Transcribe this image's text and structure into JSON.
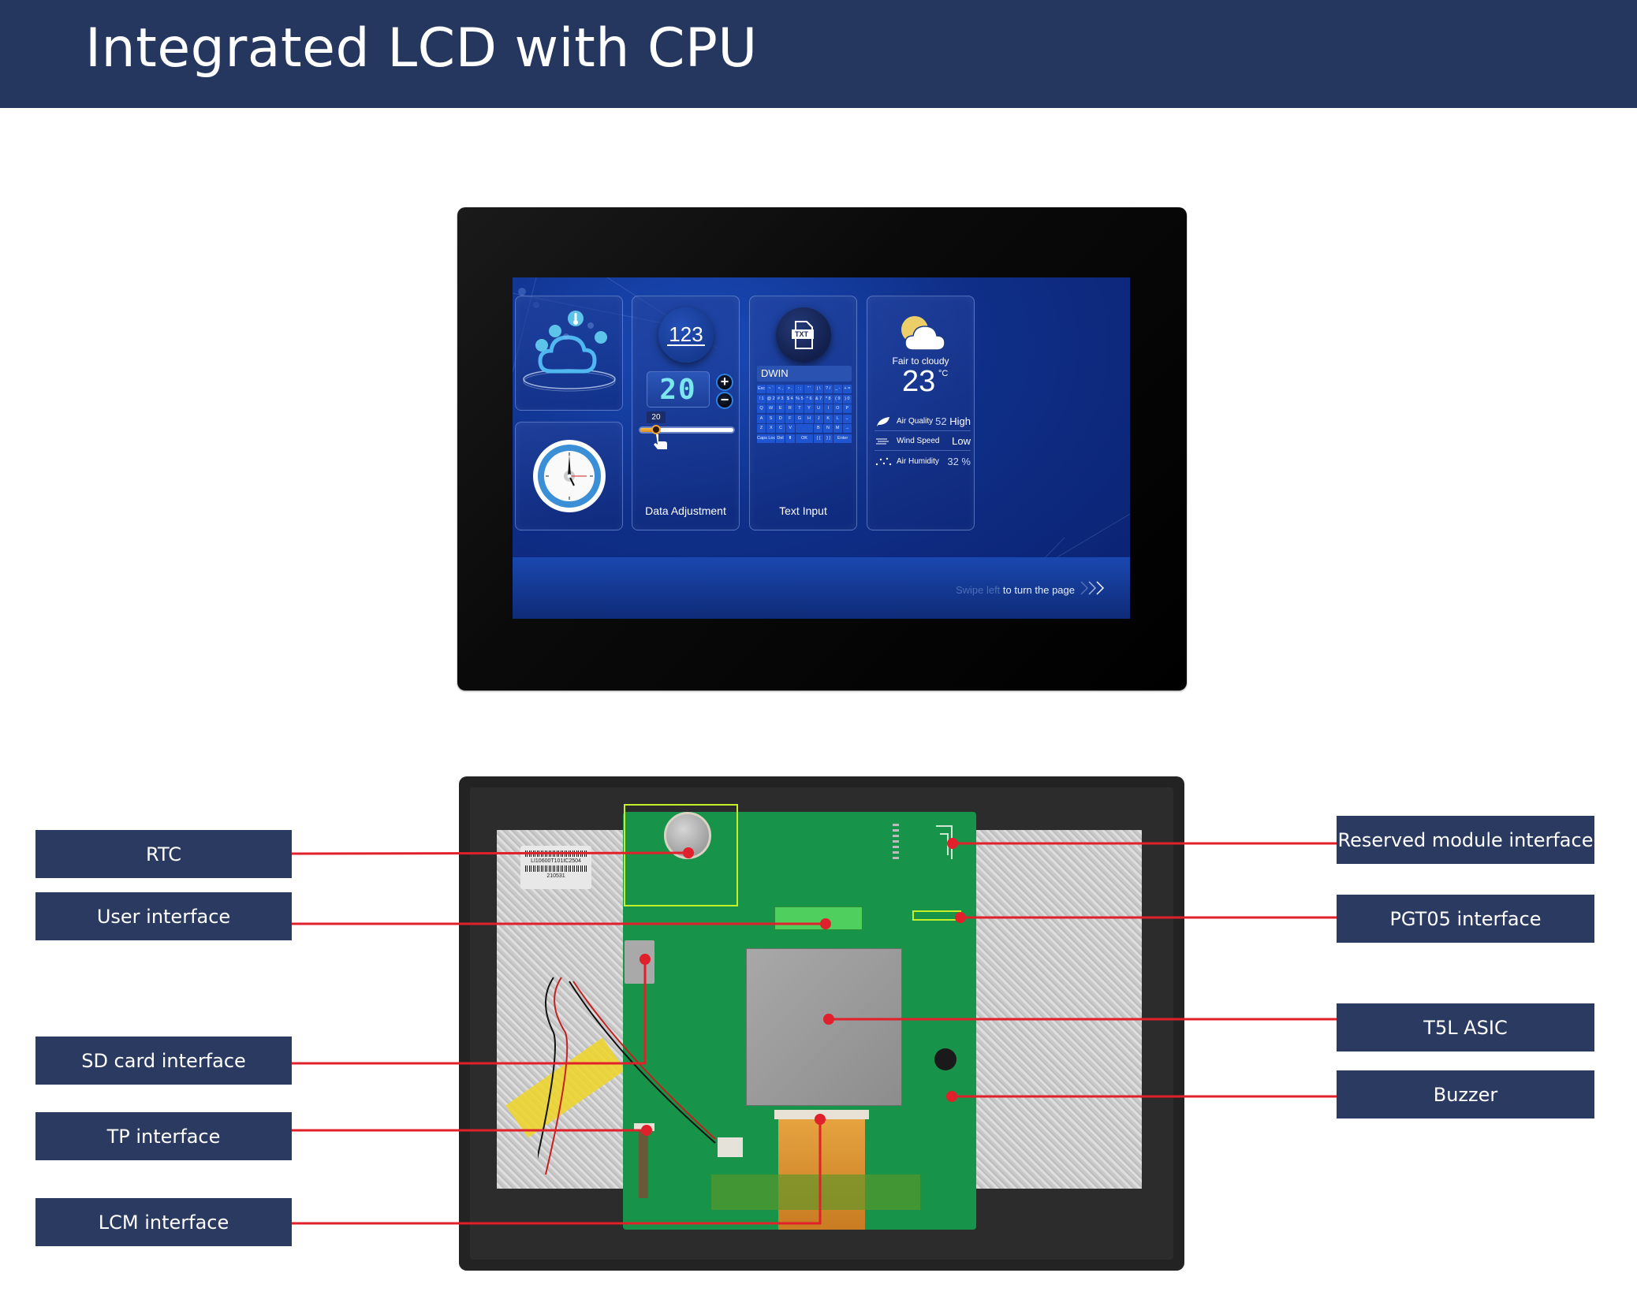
{
  "header": {
    "title": "Integrated LCD with CPU"
  },
  "screen": {
    "cards": {
      "iot": {
        "icons": [
          "cloud-icon",
          "thermometer-icon",
          "fan-icon",
          "wifi-icon",
          "globe-icon"
        ]
      },
      "clock": {
        "icon": "analog-clock-icon"
      },
      "data_adjustment": {
        "badge": "123",
        "value": "20",
        "plus_label": "+",
        "minus_label": "−",
        "slider_tip": "20",
        "slider_value_percent": 18,
        "label": "Data Adjustment"
      },
      "text_input": {
        "badge": "TXT",
        "field_value": "DWIN",
        "keyboard_rows": [
          [
            "Esc",
            "~ `",
            "< ,",
            "> .",
            ": ;",
            "\" '",
            "| \\",
            "? /",
            "_ -",
            "+ ="
          ],
          [
            "! 1",
            "@ 2",
            "# 3",
            "$ 4",
            "% 5",
            "^ 6",
            "& 7",
            "* 8",
            "( 9",
            ") 0"
          ],
          [
            "Q",
            "W",
            "E",
            "R",
            "T",
            "Y",
            "U",
            "I",
            "O",
            "P"
          ],
          [
            "A",
            "S",
            "D",
            "F",
            "G",
            "H",
            "J",
            "K",
            "L",
            "←"
          ],
          [
            "Z",
            "X",
            "C",
            "V",
            "",
            "B",
            "N",
            "M",
            "→"
          ],
          [
            "Caps Lock",
            "Del",
            "⬆",
            "OK",
            "{ [",
            "} ]",
            "Enter"
          ]
        ],
        "label": "Text Input"
      },
      "weather": {
        "condition": "Fair to cloudy",
        "temperature": "23",
        "unit": "°C",
        "rows": [
          {
            "icon": "leaf-icon",
            "label": "Air Quality",
            "value_num": "52",
            "value_text": "High"
          },
          {
            "icon": "wind-icon",
            "label": "Wind Speed",
            "value_num": "",
            "value_text": "Low"
          },
          {
            "icon": "humidity-dots-icon",
            "label": "Air Humidity",
            "value_num": "32 %",
            "value_text": ""
          }
        ]
      }
    },
    "swipe_hint_faded": "Swipe left",
    "swipe_hint": " to turn the page"
  },
  "rear": {
    "sticker_code": "LI10600T101IC2504",
    "sticker_batch": "210531"
  },
  "callouts": {
    "left": [
      {
        "id": "rtc",
        "label": "RTC"
      },
      {
        "id": "user-interface",
        "label": "User interface"
      },
      {
        "id": "sd-card",
        "label": "SD card interface"
      },
      {
        "id": "tp",
        "label": "TP interface"
      },
      {
        "id": "lcm",
        "label": "LCM interface"
      }
    ],
    "right": [
      {
        "id": "reserved-module",
        "label": "Reserved module interface"
      },
      {
        "id": "pgt05",
        "label": "PGT05 interface"
      },
      {
        "id": "t5l-asic",
        "label": "T5L ASIC"
      },
      {
        "id": "buzzer",
        "label": "Buzzer"
      }
    ]
  },
  "colors": {
    "header_bg": "#25375f",
    "callout_bg": "#2a3a60",
    "leader_line": "#e0202a",
    "highlight_box": "#c4f02a"
  }
}
